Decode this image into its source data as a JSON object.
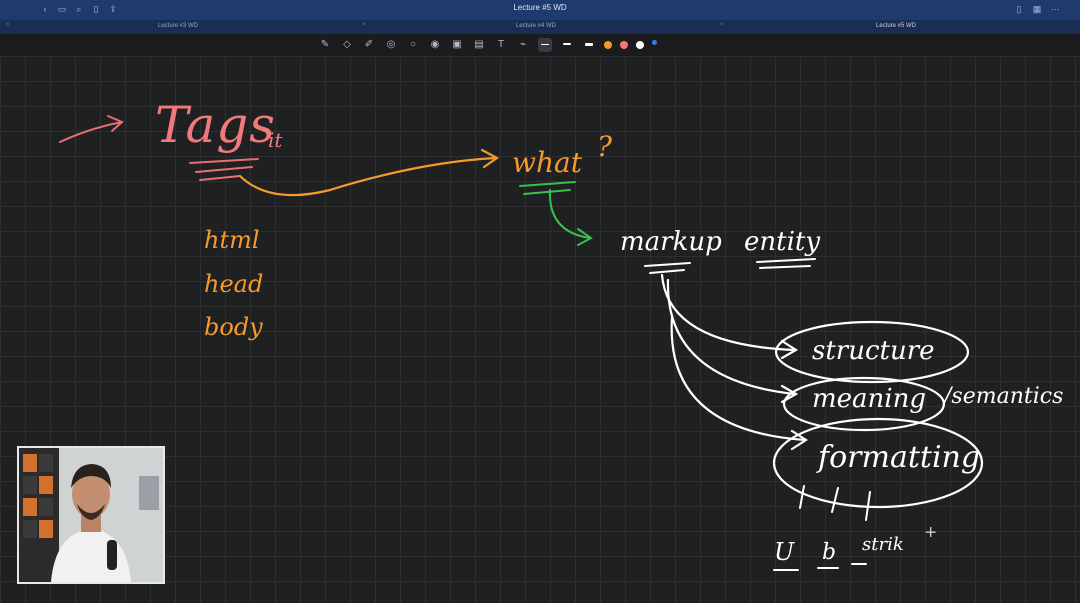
{
  "window": {
    "title": "Lecture #5 WD",
    "tabs": [
      {
        "label": "Lecture #3 WD",
        "active": false
      },
      {
        "label": "Lecture #4 WD",
        "active": false
      },
      {
        "label": "Lecture #5 WD",
        "active": true
      }
    ]
  },
  "toolbar": {
    "tools": [
      "pen-icon",
      "eraser-icon",
      "highlighter-icon",
      "shapes-icon",
      "lasso-icon",
      "camera-icon",
      "image-icon",
      "keyboard-icon",
      "text-icon",
      "link-icon"
    ],
    "colors": [
      "#f59a2c",
      "#f07a7a",
      "#ffffff",
      "#2f7df0"
    ]
  },
  "notes": {
    "tags_word": "Tags",
    "tags_suffix": "it",
    "what_word": "what",
    "what_mark": "?",
    "tag_list": [
      "html",
      "head",
      "body"
    ],
    "markup": "markup",
    "entity": "entity",
    "branches": [
      "structure",
      "meaning",
      "formatting"
    ],
    "semantics": "/semantics",
    "examples": [
      "U",
      "b",
      "strik"
    ],
    "plus": "+"
  }
}
